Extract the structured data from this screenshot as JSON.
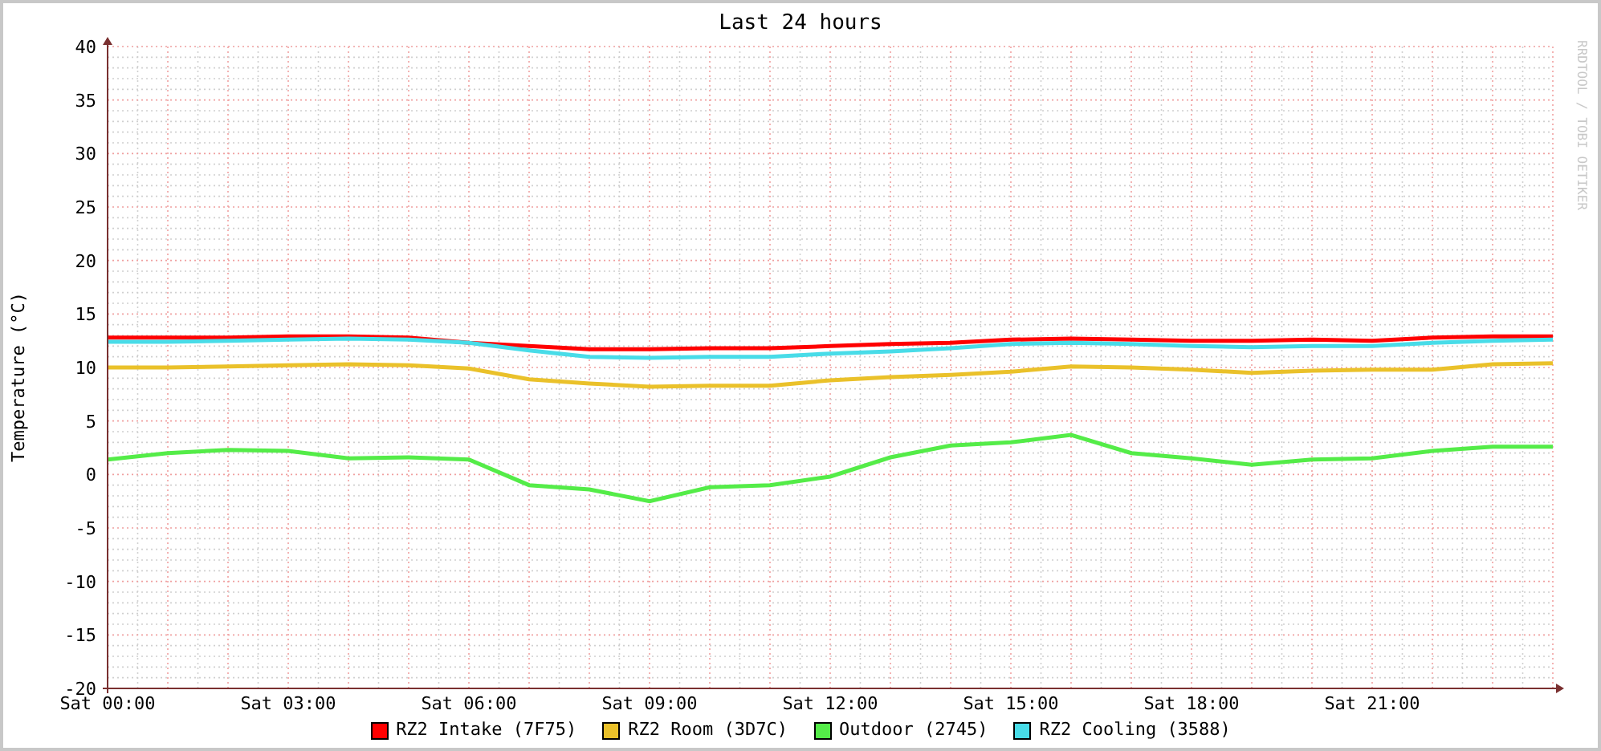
{
  "graph": {
    "credit": "RRDTOOL / TOBI OETIKER",
    "chart_data": {
      "type": "line",
      "title": "Last 24 hours",
      "ylabel": "Temperature (°C)",
      "ylim": [
        -20,
        40
      ],
      "grid": true,
      "categories": [
        "Sat 00:00",
        null,
        null,
        "Sat 03:00",
        null,
        null,
        "Sat 06:00",
        null,
        null,
        "Sat 09:00",
        null,
        null,
        "Sat 12:00",
        null,
        null,
        "Sat 15:00",
        null,
        null,
        "Sat 18:00",
        null,
        null,
        "Sat 21:00",
        null,
        null,
        null
      ],
      "yticks": [
        -20,
        -15,
        -10,
        -5,
        0,
        5,
        10,
        15,
        20,
        25,
        30,
        35,
        40
      ],
      "series": [
        {
          "name": "RZ2 Intake (7F75)",
          "color": "#ff0000",
          "values": [
            12.8,
            12.8,
            12.8,
            12.9,
            12.9,
            12.8,
            12.3,
            12.0,
            11.7,
            11.7,
            11.8,
            11.8,
            12.0,
            12.2,
            12.3,
            12.6,
            12.7,
            12.6,
            12.5,
            12.5,
            12.6,
            12.5,
            12.8,
            12.9,
            12.9
          ]
        },
        {
          "name": "RZ2 Room (3D7C)",
          "color": "#eac12a",
          "values": [
            10.0,
            10.0,
            10.1,
            10.2,
            10.3,
            10.2,
            9.9,
            8.9,
            8.5,
            8.2,
            8.3,
            8.3,
            8.8,
            9.1,
            9.3,
            9.6,
            10.1,
            10.0,
            9.8,
            9.5,
            9.7,
            9.8,
            9.8,
            10.3,
            10.4
          ]
        },
        {
          "name": "Outdoor (2745)",
          "color": "#54ec48",
          "values": [
            1.4,
            2.0,
            2.3,
            2.2,
            1.5,
            1.6,
            1.4,
            -1.0,
            -1.4,
            -2.5,
            -1.2,
            -1.0,
            -0.2,
            1.6,
            2.7,
            3.0,
            3.7,
            2.0,
            1.5,
            0.9,
            1.4,
            1.5,
            2.2,
            2.6,
            2.6
          ]
        },
        {
          "name": "RZ2 Cooling (3588)",
          "color": "#48dce8",
          "values": [
            12.4,
            12.4,
            12.5,
            12.6,
            12.7,
            12.6,
            12.3,
            11.6,
            11.0,
            10.9,
            11.0,
            11.0,
            11.3,
            11.5,
            11.8,
            12.2,
            12.3,
            12.2,
            12.0,
            11.9,
            12.0,
            12.0,
            12.3,
            12.5,
            12.6
          ]
        }
      ]
    }
  }
}
